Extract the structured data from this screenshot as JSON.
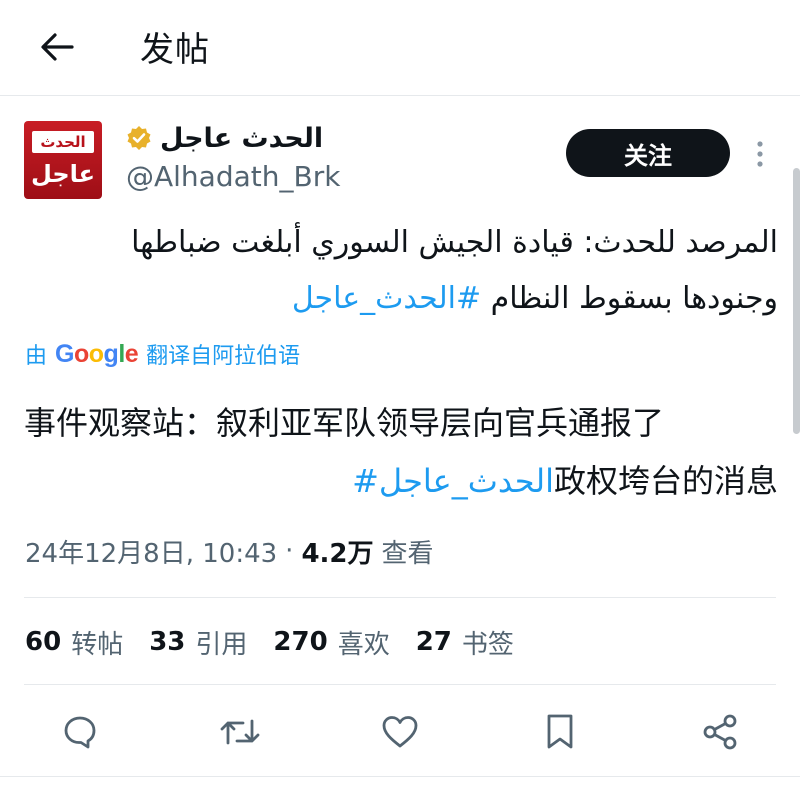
{
  "header": {
    "title": "发帖",
    "back_icon": "arrow-left-icon"
  },
  "author": {
    "avatar_top_word": "الحدث",
    "avatar_bottom_word": "عاجل",
    "name": "الحدث عاجل",
    "handle": "@Alhadath_Brk",
    "verified_color": "#e8b12b",
    "follow_label": "关注",
    "more_icon": "more-vertical-icon"
  },
  "tweet": {
    "original_text": "المرصد للحدث: قيادة الجيش السوري أبلغت ضباطها وجنودها بسقوط النظام",
    "original_hashtag": "#الحدث_عاجل",
    "translate_prefix": "由",
    "translate_brand": "Google",
    "translate_suffix": "翻译自阿拉伯语",
    "translated_line1": "事件观察站：叙利亚军队领导层向官兵通报了",
    "translated_hashtag": "#الحدث_عاجل",
    "translated_line2_rest": "政权垮台的消息"
  },
  "meta": {
    "timestamp": "24年12月8日, 10:43",
    "separator": "·",
    "views_count": "4.2万",
    "views_label": "查看"
  },
  "stats": [
    {
      "num": "60",
      "label": "转帖"
    },
    {
      "num": "33",
      "label": "引用"
    },
    {
      "num": "270",
      "label": "喜欢"
    },
    {
      "num": "27",
      "label": "书签"
    }
  ],
  "actions": [
    "reply-icon",
    "retweet-icon",
    "like-icon",
    "bookmark-icon",
    "share-icon"
  ],
  "colors": {
    "link": "#1d9bf0",
    "text": "#0f1419",
    "muted": "#536471",
    "avatar_red": "#c81d25"
  }
}
